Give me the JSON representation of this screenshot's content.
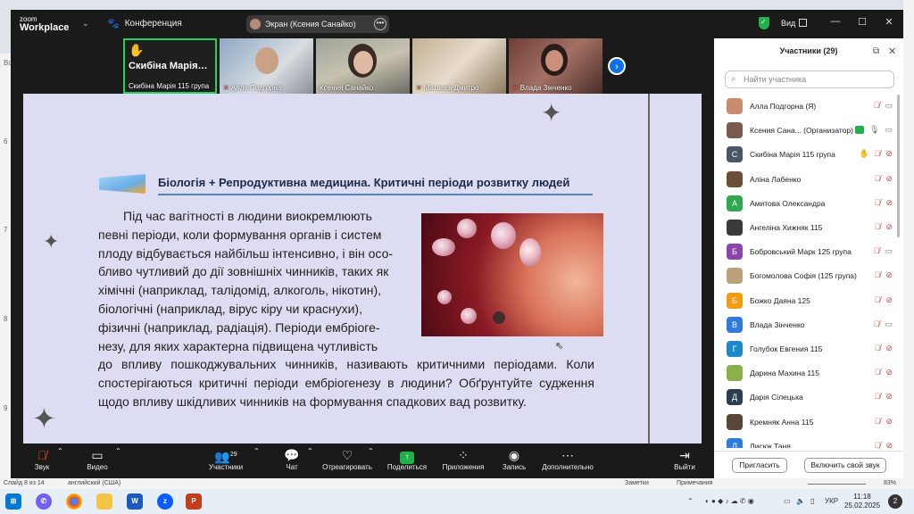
{
  "zoom": {
    "brand_small": "zoom",
    "brand_big": "Workplace",
    "meeting_label": "Конференция",
    "screen_pill": "Экран (Ксения Санайко)",
    "view_label": "Вид",
    "colors": {
      "active_green": "#23d160",
      "zoom_blue": "#0e71eb",
      "mute_red": "#e03c31",
      "bar_bg": "#1a1a1a"
    }
  },
  "video_tiles": [
    {
      "name": "Скибіна Марія 115 група",
      "big_name": "Скибіна Марія…",
      "active": true,
      "hand_raised": true
    },
    {
      "name": "Алла Подгорна",
      "muted": true
    },
    {
      "name": "Ксения Санайко",
      "muted": false
    },
    {
      "name": "Матвеєв Дмитро",
      "muted": true
    },
    {
      "name": "Влада Зінченко",
      "muted": true
    }
  ],
  "slide": {
    "heading": "Біологія + Репродуктивна медицина. Критичні періоди розвитку людей",
    "para1_lines": [
      "Під час вагітності в людини виокремлюють",
      "певні періоди, коли формування органів і систем",
      "плоду відбувається найбільш інтенсивно, і він осо-",
      "бливо чутливий до дії зовнішніх чинників, таких як",
      "хімічні (наприклад, талідомід, алкоголь, нікотин),",
      "біологічні (наприклад, вірус кіру чи краснухи),",
      "фізичні (наприклад, радіація). Періоди ембріоге-",
      "незу, для яких характерна підвищена чутливість"
    ],
    "para2": "до впливу пошкоджувальних чинників, називають критичними періодами. Коли спостерігаються критичні періоди ембріогенезу в людини? Обґрунтуйте судження щодо впливу шкідливих чинників на формування спадкових вад розвитку."
  },
  "toolbar": {
    "sound": "Звук",
    "video": "Видео",
    "participants": "Участники",
    "participants_count": "29",
    "chat": "Чат",
    "react": "Отреагировать",
    "share": "Поделиться",
    "apps": "Приложения",
    "record": "Запись",
    "more": "Дополнительно",
    "leave": "Выйти"
  },
  "panel": {
    "title": "Участники (29)",
    "search_placeholder": "Найти участника",
    "invite": "Пригласить",
    "unmute_me": "Включить свой звук",
    "participants": [
      {
        "name": "Алла Подгорна (Я)",
        "initial": "",
        "color": "#c98a6e",
        "mic": "off",
        "cam": "on"
      },
      {
        "name": "Ксения Сана... (Организатор)",
        "initial": "",
        "color": "#7a5a4e",
        "mic": "on",
        "cam": "on",
        "host": true
      },
      {
        "name": "Скибіна Марія 115 група",
        "initial": "С",
        "color": "#4a5568",
        "mic": "off",
        "cam": "off",
        "hand": true
      },
      {
        "name": "Аліна Лабенко",
        "initial": "",
        "color": "#6b4f3a",
        "mic": "off",
        "cam": "off"
      },
      {
        "name": "Амитова Олександра",
        "initial": "А",
        "color": "#2fa84f",
        "mic": "off",
        "cam": "off"
      },
      {
        "name": "Ангеліна Хижняк 115",
        "initial": "",
        "color": "#3a3a3a",
        "mic": "off",
        "cam": "off"
      },
      {
        "name": "Бобровський Марк 125 група",
        "initial": "Б",
        "color": "#8e44ad",
        "mic": "off",
        "cam": "on"
      },
      {
        "name": "Богомолова Софія (125 група)",
        "initial": "",
        "color": "#b9a27a",
        "mic": "off",
        "cam": "off"
      },
      {
        "name": "Божко Даяна 125",
        "initial": "Б",
        "color": "#f39c12",
        "mic": "off",
        "cam": "off"
      },
      {
        "name": "Влада Зінченко",
        "initial": "В",
        "color": "#2d7be0",
        "mic": "off",
        "cam": "on"
      },
      {
        "name": "Голубок Евгения 115",
        "initial": "Г",
        "color": "#1e88c8",
        "mic": "off",
        "cam": "off"
      },
      {
        "name": "Дарина Махина 115",
        "initial": "",
        "color": "#8ab04a",
        "mic": "off",
        "cam": "off"
      },
      {
        "name": "Дарія Сілецька",
        "initial": "Д",
        "color": "#2c3e50",
        "mic": "off",
        "cam": "off"
      },
      {
        "name": "Кремняк Анна 115",
        "initial": "",
        "color": "#5a4636",
        "mic": "off",
        "cam": "off"
      },
      {
        "name": "Лисюк Таня",
        "initial": "Л",
        "color": "#2d7be0",
        "mic": "off",
        "cam": "off"
      }
    ]
  },
  "ppt_status": {
    "slide": "Слайд 8 из 14",
    "lang": "английский (США)",
    "notes": "Заметки",
    "comments": "Примечания",
    "zoom": "83%"
  },
  "left_rulers": [
    "Во",
    "6",
    "7",
    "8",
    "9"
  ],
  "taskbar": {
    "lang": "УКР",
    "time": "11:18",
    "date": "25.02.2025",
    "notifications": "2",
    "apps": [
      "viber",
      "chrome",
      "explorer",
      "word",
      "zoom",
      "powerpoint"
    ]
  }
}
